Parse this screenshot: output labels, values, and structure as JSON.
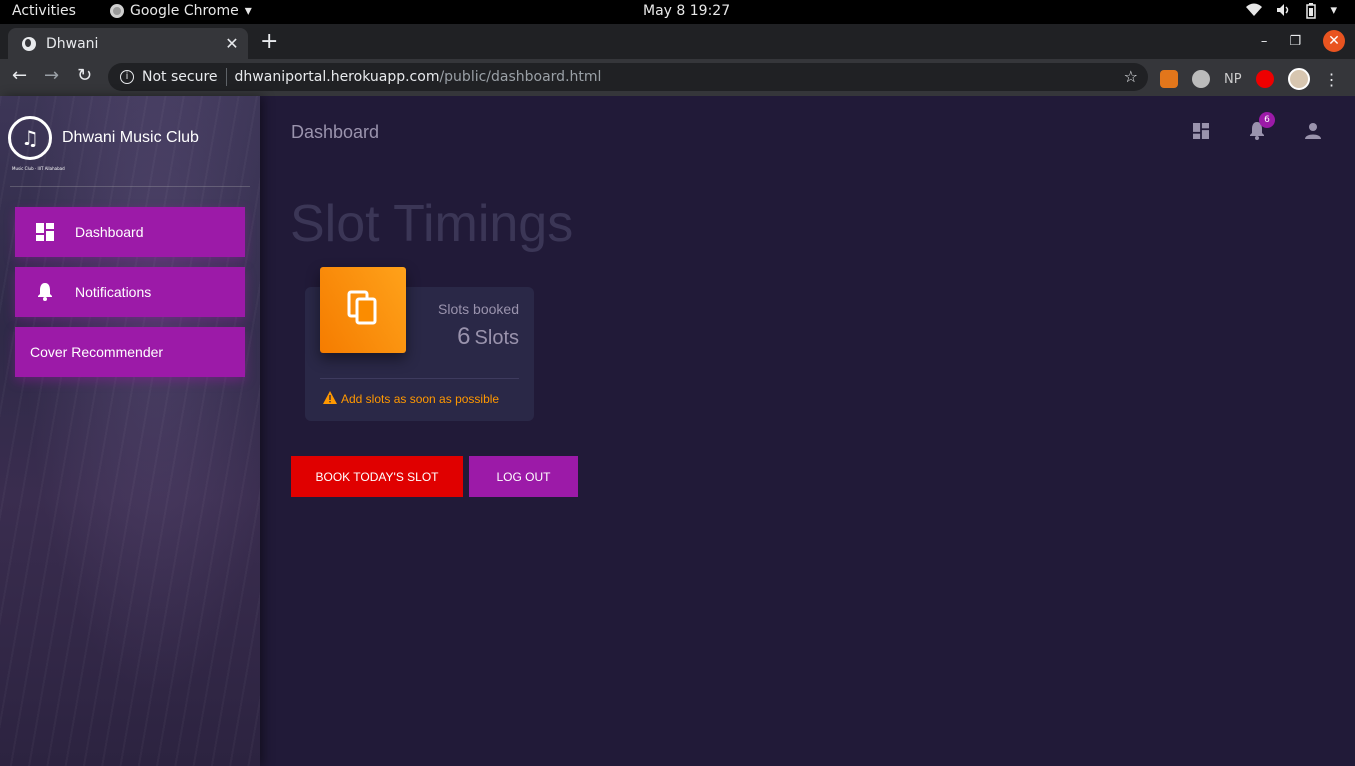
{
  "os_bar": {
    "activities": "Activities",
    "app_name": "Google Chrome",
    "clock": "May 8  19:27"
  },
  "browser": {
    "tab_title": "Dhwani",
    "security_label": "Not secure",
    "url_host": "dhwaniportal.herokuapp.com",
    "url_path": "/public/dashboard.html",
    "extension_np": "NP"
  },
  "sidebar": {
    "brand": "Dhwani Music Club",
    "brand_sub": "Music Club · IIIT Allahabad",
    "items": [
      {
        "label": "Dashboard",
        "icon": "dashboard-icon"
      },
      {
        "label": "Notifications",
        "icon": "bell-icon"
      },
      {
        "label": "Cover Recommender"
      }
    ]
  },
  "header": {
    "title": "Dashboard",
    "notification_count": "6"
  },
  "main": {
    "heading": "Slot Timings",
    "card": {
      "category": "Slots booked",
      "value": "6",
      "unit": "Slots",
      "footer": "Add slots as soon as possible"
    },
    "buttons": {
      "book": "Book Today's Slot",
      "logout": "Log Out"
    }
  },
  "colors": {
    "accent_purple": "#9c1aa8",
    "danger_red": "#e00000",
    "warning_orange": "#ff9800",
    "page_bg": "#211a38"
  }
}
